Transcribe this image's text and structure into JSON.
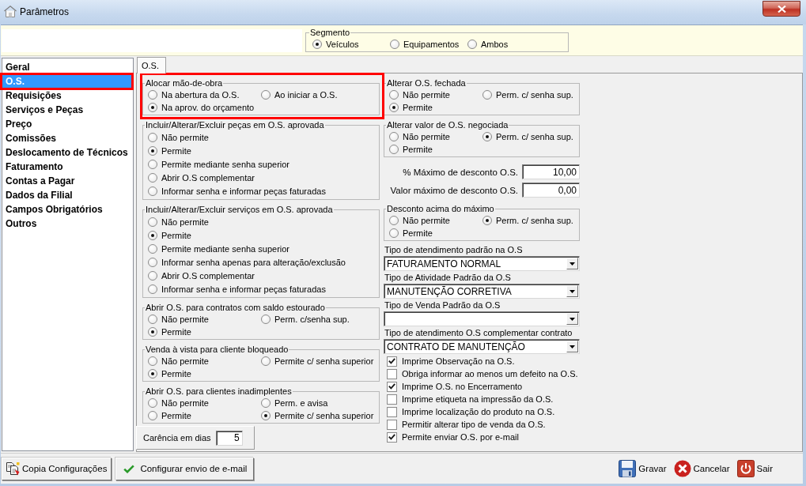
{
  "window": {
    "title": "Parâmetros"
  },
  "segment": {
    "legend": "Segmento",
    "options": [
      {
        "label": "Veículos",
        "selected": true
      },
      {
        "label": "Equipamentos",
        "selected": false
      },
      {
        "label": "Ambos",
        "selected": false
      }
    ]
  },
  "sidebar": {
    "items": [
      {
        "label": "Geral",
        "selected": false,
        "highlighted": false
      },
      {
        "label": "O.S.",
        "selected": true,
        "highlighted": true
      },
      {
        "label": "Requisições",
        "selected": false,
        "highlighted": false
      },
      {
        "label": "Serviços e Peças",
        "selected": false,
        "highlighted": false
      },
      {
        "label": "Preço",
        "selected": false,
        "highlighted": false
      },
      {
        "label": "Comissões",
        "selected": false,
        "highlighted": false
      },
      {
        "label": "Deslocamento de Técnicos",
        "selected": false,
        "highlighted": false
      },
      {
        "label": "Faturamento",
        "selected": false,
        "highlighted": false
      },
      {
        "label": "Contas a Pagar",
        "selected": false,
        "highlighted": false
      },
      {
        "label": "Dados da Filial",
        "selected": false,
        "highlighted": false
      },
      {
        "label": "Campos Obrigatórios",
        "selected": false,
        "highlighted": false
      },
      {
        "label": "Outros",
        "selected": false,
        "highlighted": false
      }
    ]
  },
  "tabs": [
    {
      "label": "O.S.",
      "selected": true
    }
  ],
  "left_column": {
    "groups": [
      {
        "kind": "grid",
        "legend": "Alocar mão-de-obra",
        "highlighted": true,
        "options": [
          {
            "label": "Na abertura da O.S.",
            "selected": false
          },
          {
            "label": "Ao iniciar a O.S.",
            "selected": false
          },
          {
            "label": "Na aprov. do orçamento",
            "selected": true
          }
        ]
      },
      {
        "kind": "list",
        "legend": "Incluir/Alterar/Excluir peças em O.S. aprovada",
        "highlighted": false,
        "options": [
          {
            "label": "Não permite",
            "selected": false
          },
          {
            "label": "Permite",
            "selected": true
          },
          {
            "label": "Permite mediante senha superior",
            "selected": false
          },
          {
            "label": "Abrir O.S complementar",
            "selected": false
          },
          {
            "label": "Informar senha e informar peças faturadas",
            "selected": false
          }
        ]
      },
      {
        "kind": "list",
        "legend": "Incluir/Alterar/Excluir serviços em O.S. aprovada",
        "highlighted": false,
        "options": [
          {
            "label": "Não permite",
            "selected": false
          },
          {
            "label": "Permite",
            "selected": true
          },
          {
            "label": "Permite mediante senha superior",
            "selected": false
          },
          {
            "label": "Informar senha apenas para alteração/exclusão",
            "selected": false
          },
          {
            "label": "Abrir O.S complementar",
            "selected": false
          },
          {
            "label": "Informar senha e informar peças faturadas",
            "selected": false
          }
        ]
      },
      {
        "kind": "grid",
        "legend": "Abrir O.S. para contratos com saldo estourado",
        "highlighted": false,
        "options": [
          {
            "label": "Não permite",
            "selected": false
          },
          {
            "label": "Perm. c/senha sup.",
            "selected": false
          },
          {
            "label": "Permite",
            "selected": true
          }
        ]
      },
      {
        "kind": "grid",
        "legend": "Venda à vista para cliente bloqueado",
        "highlighted": false,
        "options": [
          {
            "label": "Não permite",
            "selected": false
          },
          {
            "label": "Permite c/ senha superior",
            "selected": false
          },
          {
            "label": "Permite",
            "selected": true
          }
        ]
      },
      {
        "kind": "grid",
        "legend": "Abrir O.S. para clientes inadimplentes",
        "highlighted": false,
        "options": [
          {
            "label": "Não permite",
            "selected": false
          },
          {
            "label": "Perm. e avisa",
            "selected": false
          },
          {
            "label": "Permite",
            "selected": false
          },
          {
            "label": "Permite c/ senha superior",
            "selected": true
          }
        ]
      }
    ],
    "grace_days": {
      "label": "Carência em dias",
      "value": "5"
    }
  },
  "right_column": [
    {
      "kind": "radio_group",
      "legend": "Alterar O.S. fechada",
      "options": [
        {
          "label": "Não permite",
          "selected": false
        },
        {
          "label": "Perm. c/ senha sup.",
          "selected": false
        },
        {
          "label": "Permite",
          "selected": true
        }
      ]
    },
    {
      "kind": "radio_group",
      "legend": "Alterar valor de O.S. negociada",
      "options": [
        {
          "label": "Não permite",
          "selected": false
        },
        {
          "label": "Perm. c/ senha sup.",
          "selected": true
        },
        {
          "label": "Permite",
          "selected": false
        }
      ]
    },
    {
      "kind": "number_field",
      "label": "% Máximo de desconto O.S.",
      "value": "10,00"
    },
    {
      "kind": "number_field",
      "label": "Valor máximo de desconto O.S.",
      "value": "0,00"
    },
    {
      "kind": "radio_group",
      "legend": "Desconto acima do máximo",
      "options": [
        {
          "label": "Não permite",
          "selected": false
        },
        {
          "label": "Perm. c/ senha sup.",
          "selected": true
        },
        {
          "label": "Permite",
          "selected": false
        }
      ]
    },
    {
      "kind": "select",
      "label": "Tipo de atendimento padrão na O.S",
      "value": "FATURAMENTO NORMAL"
    },
    {
      "kind": "select",
      "label": "Tipo de Atividade Padrão da O.S",
      "value": "MANUTENÇÃO CORRETIVA"
    },
    {
      "kind": "select",
      "label": "Tipo de Venda Padrão da O.S"
    },
    {
      "kind": "select",
      "label": "Tipo de atendimento O.S complementar contrato",
      "value": "CONTRATO DE MANUTENÇÃO"
    },
    {
      "kind": "checkbox",
      "label": "Imprime Observação na O.S.",
      "checked": true
    },
    {
      "kind": "checkbox",
      "label": "Obriga informar ao menos um defeito na O.S.",
      "checked": false
    },
    {
      "kind": "checkbox",
      "label": "Imprime O.S. no Encerramento",
      "checked": true
    },
    {
      "kind": "checkbox",
      "label": "Imprime etiqueta na impressão da O.S.",
      "checked": false
    },
    {
      "kind": "checkbox",
      "label": "Imprime localização do produto na O.S.",
      "checked": false
    },
    {
      "kind": "checkbox",
      "label": "Permitir alterar tipo de venda da O.S.",
      "checked": false
    },
    {
      "kind": "checkbox",
      "label": "Permite enviar O.S. por e-mail",
      "checked": true
    }
  ],
  "bottom_bar": {
    "left_buttons": [
      {
        "label": "Copia Configurações"
      },
      {
        "label": "Configurar envio de e-mail"
      }
    ],
    "right_buttons": [
      {
        "label": "Gravar"
      },
      {
        "label": "Cancelar"
      },
      {
        "label": "Sair"
      }
    ]
  }
}
